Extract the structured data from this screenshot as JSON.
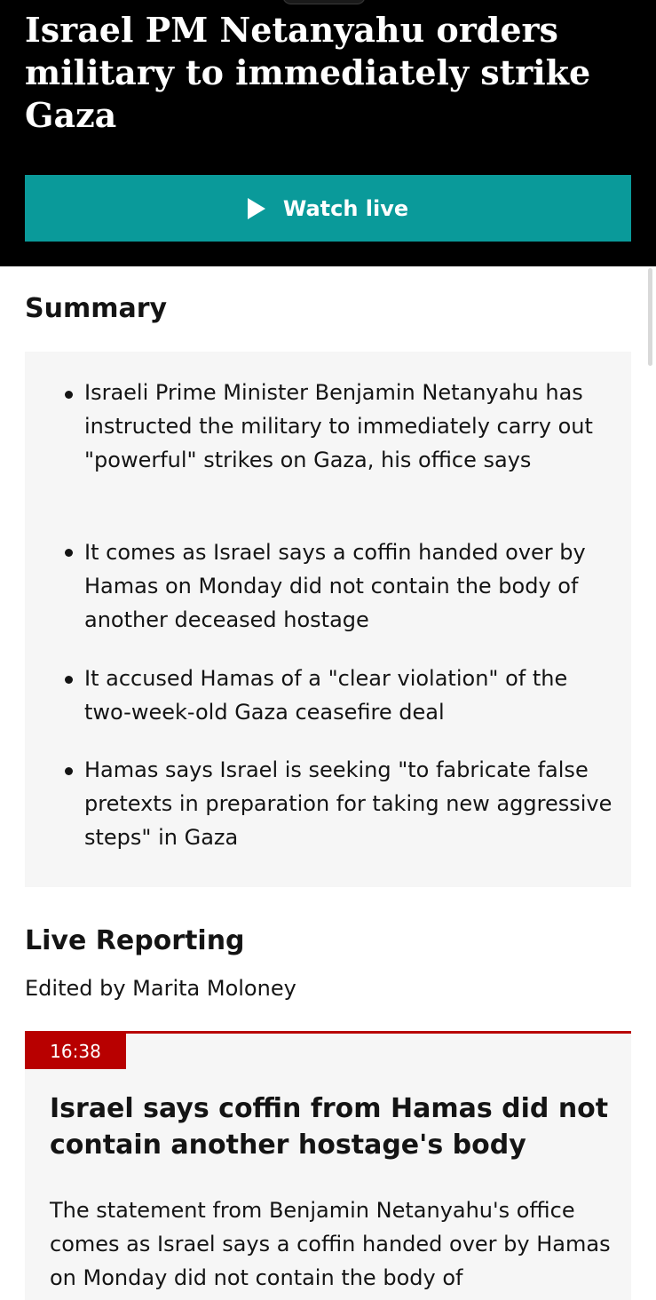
{
  "header": {
    "headline": "Israel PM Netanyahu orders military to immediately strike Gaza",
    "watch_live_label": "Watch live",
    "play_icon": "play-icon"
  },
  "summary": {
    "heading": "Summary",
    "items": [
      "Israeli Prime Minister Benjamin Netanyahu has instructed the military to immediately carry out \"powerful\" strikes on Gaza, his office says",
      "It comes as Israel says a coffin handed over by Hamas on Monday did not contain the body of another deceased hostage",
      "It accused Hamas of a \"clear violation\" of the two-week-old Gaza ceasefire deal",
      "Hamas says Israel is seeking \"to fabricate false pretexts in preparation for taking new aggressive steps\" in Gaza"
    ]
  },
  "live_reporting": {
    "heading": "Live Reporting",
    "editor": "Edited by Marita Moloney",
    "posts": [
      {
        "time": "16:38",
        "title": "Israel says coffin from Hamas did not contain another hostage's body",
        "body": "The statement from Benjamin Netanyahu's office comes as Israel says a coffin handed over by Hamas on Monday did not contain the body of"
      }
    ]
  },
  "colors": {
    "header_bg": "#000000",
    "watch_live_bg": "#0a9a9a",
    "summary_bg": "#f6f6f6",
    "accent_red": "#b80000"
  }
}
